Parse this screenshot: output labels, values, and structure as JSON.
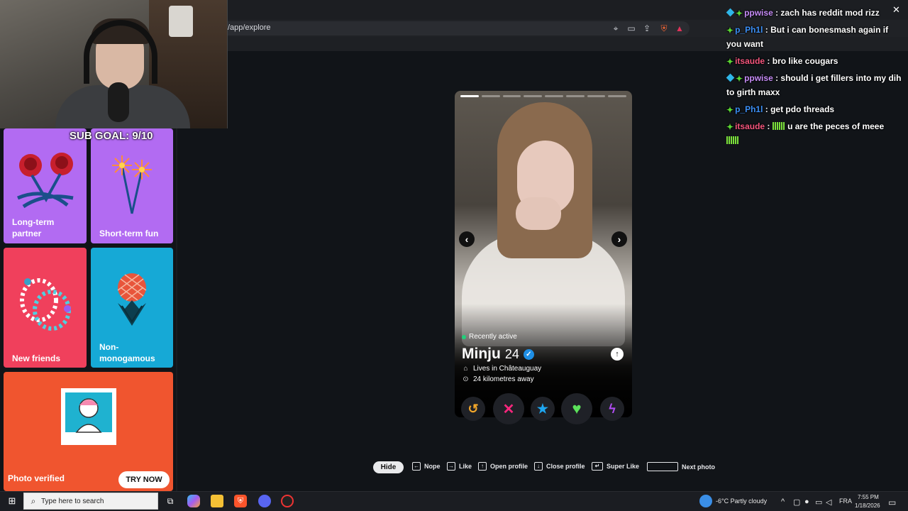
{
  "browser": {
    "url": "/app/explore",
    "icons": [
      "location-icon",
      "cast-icon",
      "share-icon",
      "brave-shield-icon",
      "brave-rewards-icon"
    ]
  },
  "stream": {
    "sub_goal": "SUB GOAL: 9/10"
  },
  "intent_tiles": [
    {
      "label_line1": "Long-term",
      "label_line2": "partner",
      "color": "#b26bf2",
      "icon": "roses-icon"
    },
    {
      "label_line1": "Short-term fun",
      "label_line2": "",
      "color": "#b26bf2",
      "icon": "sparklers-icon"
    },
    {
      "label_line1": "New friends",
      "label_line2": "",
      "color": "#f0405c",
      "icon": "friendship-bracelets-icon"
    },
    {
      "label_line1": "Non-",
      "label_line2": "monogamous",
      "color": "#16a9d6",
      "icon": "pineapple-icon"
    },
    {
      "label_line1": "Photo verified",
      "label_line2": "",
      "color": "#f0552f",
      "icon": "verified-selfie-icon",
      "button": "TRY NOW"
    }
  ],
  "profile": {
    "photo_count": 8,
    "active_photo_index": 1,
    "status": "Recently active",
    "name": "Minju",
    "age": "24",
    "lives_in": "Lives in Châteauguay",
    "distance": "24 kilometres away",
    "status_color": "#21d07a"
  },
  "actions": [
    {
      "name": "rewind",
      "glyph": "↺",
      "color": "#f2a62a"
    },
    {
      "name": "nope",
      "glyph": "✕",
      "color": "#fd267d"
    },
    {
      "name": "super-like",
      "glyph": "★",
      "color": "#1ea6f0"
    },
    {
      "name": "like",
      "glyph": "♥",
      "color": "#5be25a"
    },
    {
      "name": "boost",
      "glyph": "ϟ",
      "color": "#b24df5"
    }
  ],
  "shortcuts": {
    "hide": "Hide",
    "nope": "Nope",
    "like": "Like",
    "open_profile": "Open profile",
    "close_profile": "Close profile",
    "super_like": "Super Like",
    "next_photo": "Next photo"
  },
  "chat": [
    {
      "user": "ppwise",
      "color": "#c68cf7",
      "badges": [
        "blue",
        "green"
      ],
      "text": "zach has reddit mod rizz"
    },
    {
      "user": "p_Ph1l",
      "color": "#3b8ff5",
      "badges": [
        "green"
      ],
      "text": "But i can bonesmash again if you want"
    },
    {
      "user": "itsaude",
      "color": "#f3557c",
      "badges": [
        "green"
      ],
      "text": "bro like cougars"
    },
    {
      "user": "ppwise",
      "color": "#c68cf7",
      "badges": [
        "blue",
        "green"
      ],
      "text": "should i get fillers into my dih to girth maxx"
    },
    {
      "user": "p_Ph1l",
      "color": "#3b8ff5",
      "badges": [
        "green"
      ],
      "text": "get pdo threads"
    },
    {
      "user": "itsaude",
      "color": "#f3557c",
      "badges": [
        "green"
      ],
      "text": "u are the peces of meee",
      "emotes": true
    }
  ],
  "taskbar": {
    "search_placeholder": "Type here to search",
    "weather": "-6°C  Partly cloudy",
    "language": "FRA",
    "time": "7:55 PM",
    "date": "1/18/2026"
  }
}
